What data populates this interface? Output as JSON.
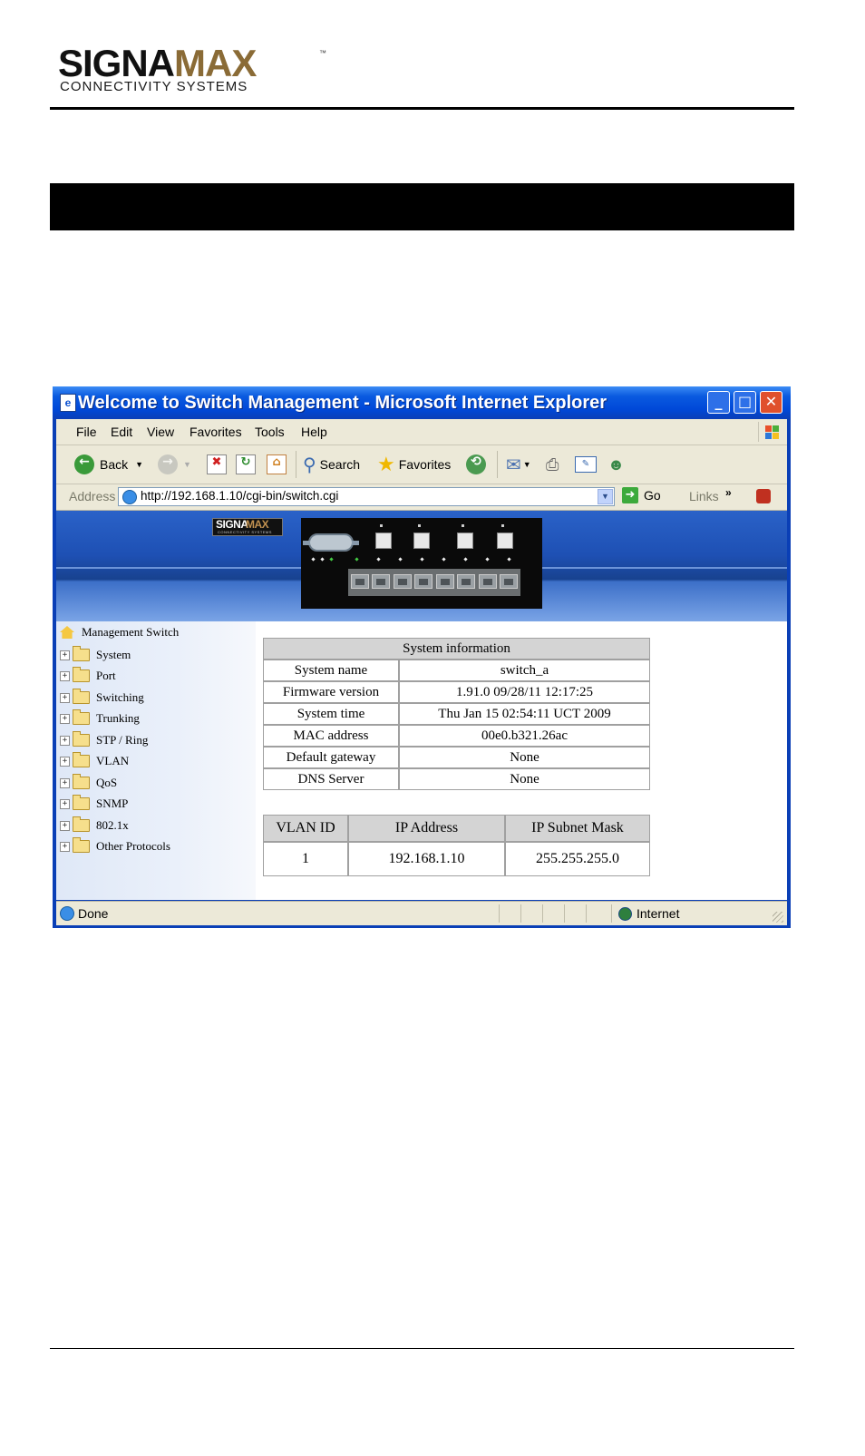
{
  "doc": {
    "brand_left": "SIGNA",
    "brand_right": "MAX",
    "trademark": "™",
    "tagline": "CONNECTIVITY SYSTEMS"
  },
  "window": {
    "title": "Welcome to Switch Management - Microsoft Internet Explorer",
    "menu": [
      "File",
      "Edit",
      "View",
      "Favorites",
      "Tools",
      "Help"
    ],
    "toolbar": {
      "back": "Back",
      "search": "Search",
      "favorites": "Favorites"
    },
    "address": {
      "label": "Address",
      "url": "http://192.168.1.10/cgi-bin/switch.cgi",
      "go": "Go",
      "links": "Links"
    },
    "status": {
      "text": "Done",
      "zone": "Internet"
    }
  },
  "banner": {
    "logo_left": "SIGNA",
    "logo_right": "MAX",
    "logo_sub": "CONNECTIVITY SYSTEMS"
  },
  "tree": {
    "root": "Management Switch",
    "items": [
      "System",
      "Port",
      "Switching",
      "Trunking",
      "STP / Ring",
      "VLAN",
      "QoS",
      "SNMP",
      "802.1x",
      "Other Protocols"
    ]
  },
  "system_info": {
    "title": "System information",
    "rows": [
      {
        "label": "System name",
        "value": "switch_a"
      },
      {
        "label": "Firmware version",
        "value": "1.91.0 09/28/11 12:17:25"
      },
      {
        "label": "System time",
        "value": "Thu Jan 15 02:54:11 UCT 2009"
      },
      {
        "label": "MAC address",
        "value": "00e0.b321.26ac"
      },
      {
        "label": "Default gateway",
        "value": "None"
      },
      {
        "label": "DNS Server",
        "value": "None"
      }
    ]
  },
  "vlan_table": {
    "headers": [
      "VLAN ID",
      "IP Address",
      "IP Subnet Mask"
    ],
    "rows": [
      [
        "1",
        "192.168.1.10",
        "255.255.255.0"
      ]
    ]
  },
  "colors": {
    "title_blue": "#0a5ae0",
    "window_frame": "#0a3fb6",
    "chrome": "#ece9d8",
    "brand_gold": "#8a6b36",
    "table_header": "#d4d4d4"
  }
}
